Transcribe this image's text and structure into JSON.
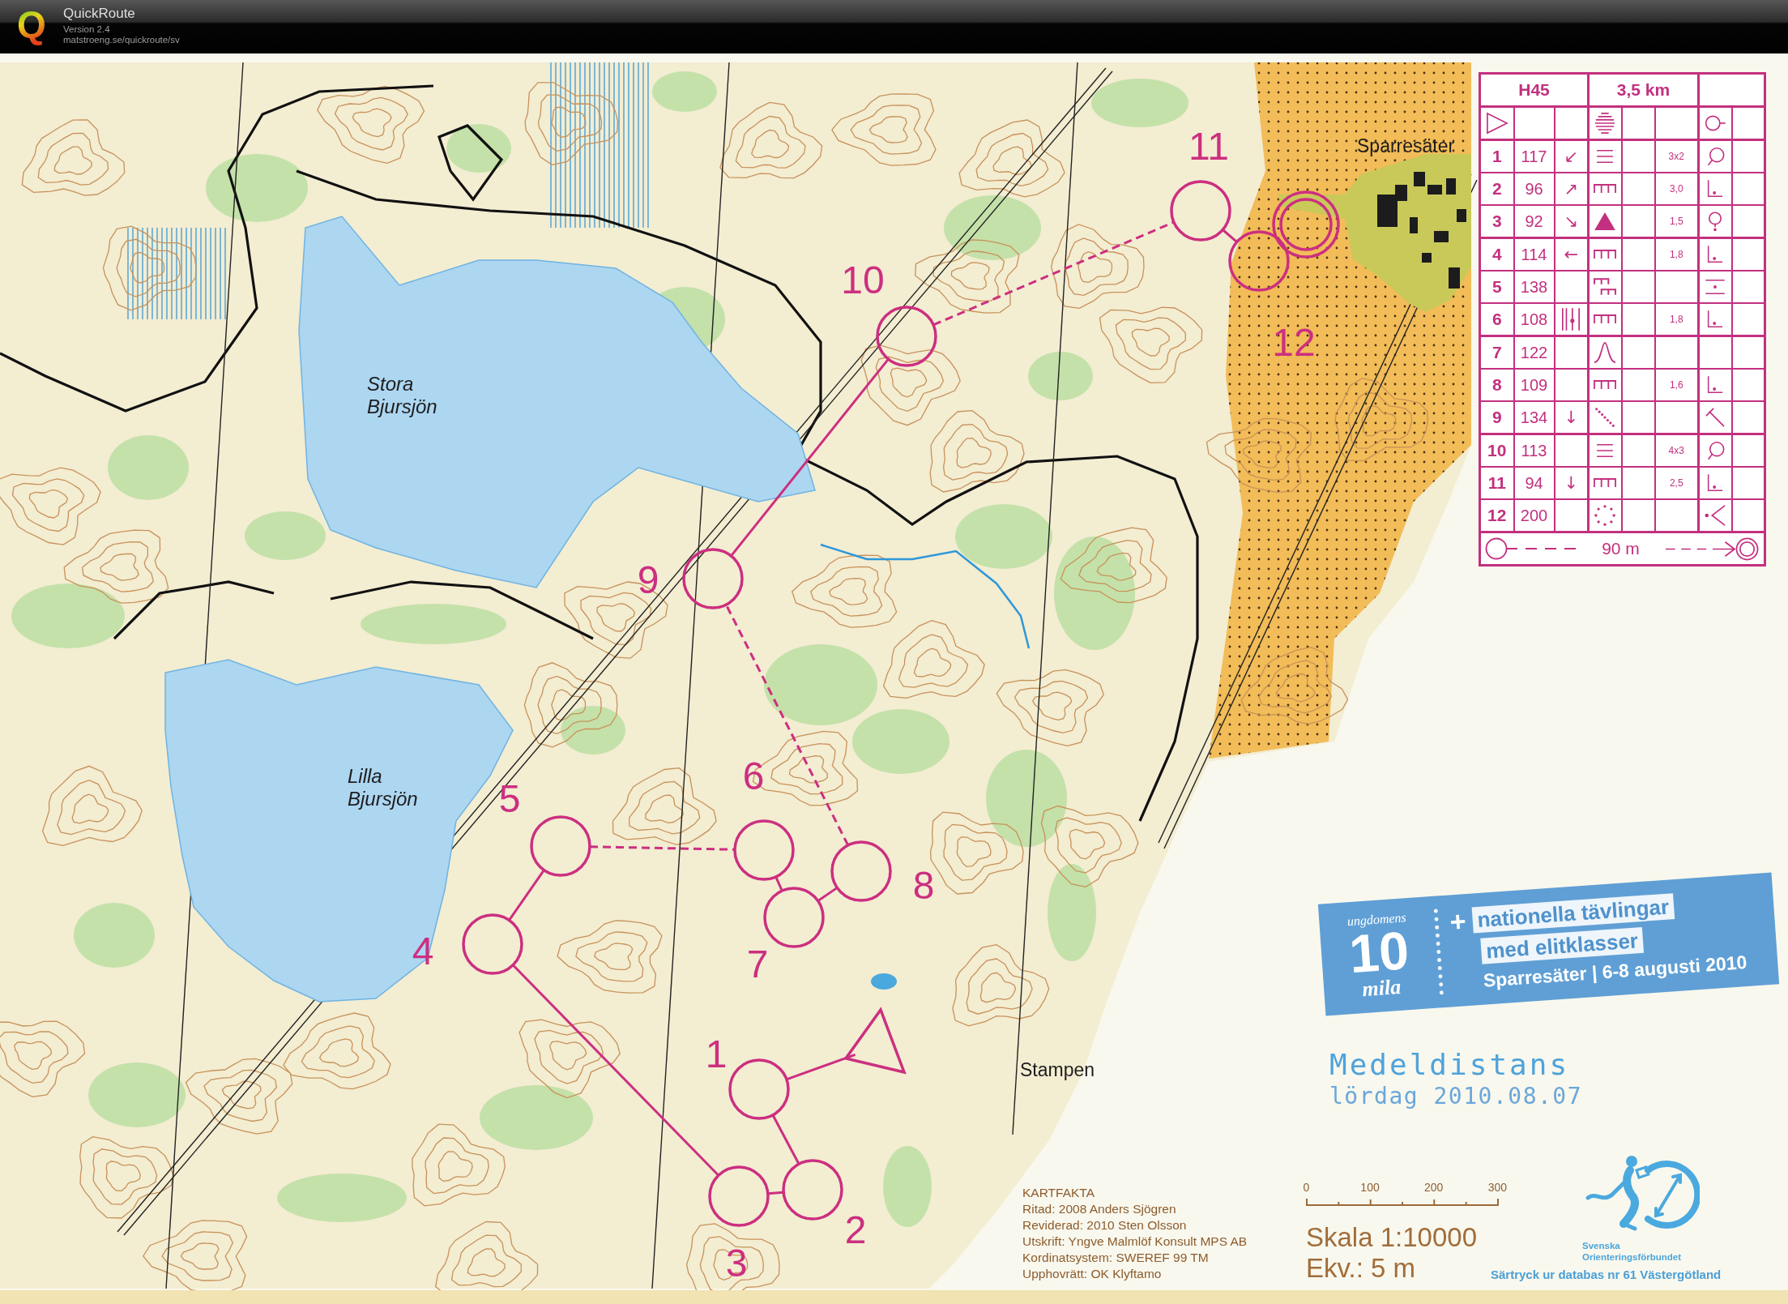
{
  "app": {
    "logo": "Q",
    "title": "QuickRoute",
    "version": "Version 2.4",
    "url": "matstroeng.se/quickroute/sv"
  },
  "map": {
    "place_names": [
      {
        "name": "Sparresäter",
        "kind": "place"
      },
      {
        "name": "Stora Bjursjön",
        "kind": "lake"
      },
      {
        "name": "Lilla Bjursjön",
        "kind": "lake"
      },
      {
        "name": "Stampen",
        "kind": "place"
      }
    ],
    "course": {
      "controls": [
        {
          "number": "1",
          "leg_dashed": false
        },
        {
          "number": "2",
          "leg_dashed": false
        },
        {
          "number": "3",
          "leg_dashed": false
        },
        {
          "number": "4",
          "leg_dashed": false
        },
        {
          "number": "5",
          "leg_dashed": false
        },
        {
          "number": "6",
          "leg_dashed": true
        },
        {
          "number": "7",
          "leg_dashed": false
        },
        {
          "number": "8",
          "leg_dashed": false
        },
        {
          "number": "9",
          "leg_dashed": true
        },
        {
          "number": "10",
          "leg_dashed": false
        },
        {
          "number": "11",
          "leg_dashed": true
        },
        {
          "number": "12",
          "leg_dashed": false
        }
      ]
    },
    "description_sheet": {
      "class": "H45",
      "length": "3,5 km",
      "start_row": {
        "feature": {
          "kind": "stripes"
        },
        "location": {
          "kind": "ring-tail"
        }
      },
      "rows": [
        {
          "number": "1",
          "code": "117",
          "direction": "↙",
          "feature": {
            "kind": "lines"
          },
          "size": "3x2",
          "location": {
            "kind": "ring-low"
          }
        },
        {
          "number": "2",
          "code": "96",
          "direction": "↗",
          "feature": {
            "kind": "comb"
          },
          "size": "3,0",
          "location": {
            "kind": "foot"
          }
        },
        {
          "number": "3",
          "code": "92",
          "direction": "↘",
          "feature": {
            "kind": "triangle"
          },
          "size": "1,5",
          "location": {
            "kind": "ring-dot"
          }
        },
        {
          "number": "4",
          "code": "114",
          "direction": "←",
          "feature": {
            "kind": "comb"
          },
          "size": "1,8",
          "location": {
            "kind": "foot"
          }
        },
        {
          "number": "5",
          "code": "138",
          "feature": {
            "kind": "combs"
          },
          "location": {
            "kind": "middle"
          }
        },
        {
          "number": "6",
          "code": "108",
          "direction_symbol": {
            "kind": "between"
          },
          "feature": {
            "kind": "comb"
          },
          "size": "1,8",
          "location": {
            "kind": "foot"
          }
        },
        {
          "number": "7",
          "code": "122",
          "feature": {
            "kind": "bell"
          }
        },
        {
          "number": "8",
          "code": "109",
          "feature": {
            "kind": "comb"
          },
          "size": "1,6",
          "location": {
            "kind": "foot"
          }
        },
        {
          "number": "9",
          "code": "134",
          "direction": "↓",
          "feature": {
            "kind": "dots"
          },
          "location": {
            "kind": "angle"
          }
        },
        {
          "number": "10",
          "code": "113",
          "feature": {
            "kind": "lines"
          },
          "size": "4x3",
          "location": {
            "kind": "ring-low"
          }
        },
        {
          "number": "11",
          "code": "94",
          "direction": "↓",
          "feature": {
            "kind": "comb"
          },
          "size": "2,5",
          "location": {
            "kind": "foot"
          }
        },
        {
          "number": "12",
          "code": "200",
          "feature": {
            "kind": "ring"
          },
          "location": {
            "kind": "dot-angle"
          }
        }
      ],
      "finish_distance": "90 m"
    },
    "event_banner": {
      "logo_top": "ungdomens",
      "logo_number": "10",
      "logo_bottom": "mila",
      "plus": "+",
      "headlines": [
        "nationella tävlingar",
        "med elitklasser"
      ],
      "venue_dates": "Sparresäter | 6-8 augusti 2010"
    },
    "event": {
      "title": "Medeldistans",
      "date": "lördag 2010.08.07"
    },
    "map_info": {
      "heading": "KARTFAKTA",
      "lines": [
        "Ritad: 2008 Anders Sjögren",
        "Reviderad: 2010 Sten Olsson",
        "Utskrift: Yngve Malmlöf Konsult MPS AB",
        "Kordinatsystem: SWEREF 99 TM",
        "Upphovrätt: OK Klyftamo"
      ]
    },
    "scale": {
      "ticks": [
        "0",
        "100",
        "200",
        "300"
      ],
      "scale": "Skala 1:10000",
      "contour_interval": "Ekv.: 5 m"
    },
    "federation": {
      "name": [
        "Svenska",
        "Orienteringsförbundet"
      ],
      "reprint": "Särtryck ur databas nr 61 Västergötland"
    }
  }
}
